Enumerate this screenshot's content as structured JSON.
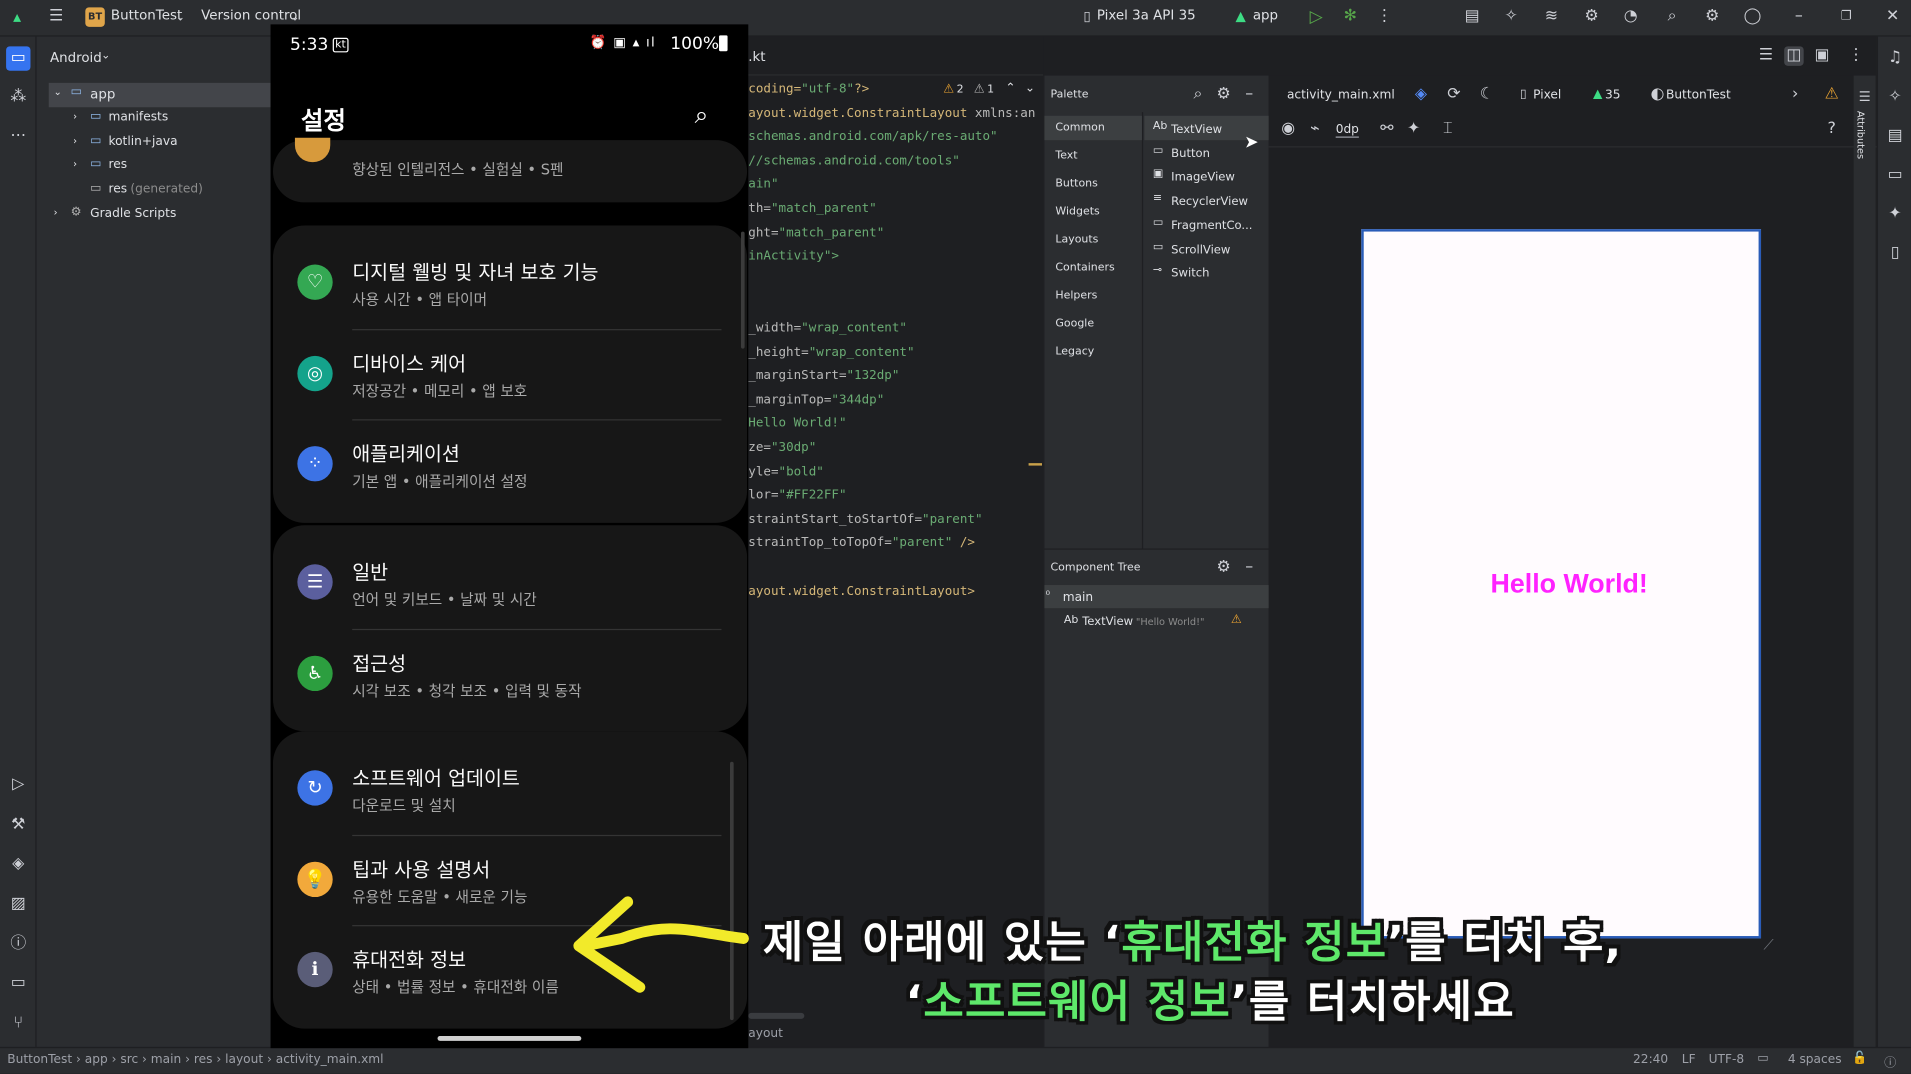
{
  "topbar": {
    "project": "ButtonTest",
    "project_badge": "BT",
    "vcs": "Version control",
    "device": "Pixel 3a API 35",
    "run_config": "app"
  },
  "project_panel": {
    "view": "Android",
    "items": [
      {
        "label": "app"
      },
      {
        "label": "manifests"
      },
      {
        "label": "kotlin+java"
      },
      {
        "label": "res"
      },
      {
        "label": "res",
        "suffix": "(generated)"
      },
      {
        "label": "Gradle Scripts"
      }
    ]
  },
  "editor": {
    "tab": ".kt",
    "warnings": "2",
    "weak_warnings": "1",
    "lines": [
      {
        "parts": [
          [
            "coding=",
            "#d5b778"
          ],
          [
            "\"utf-8\"",
            "#6aab73"
          ],
          [
            "?>",
            "#d5b778"
          ]
        ]
      },
      {
        "parts": [
          [
            "ayout.widget.ConstraintLayout",
            "#d5b778"
          ],
          [
            " xmlns:an",
            "#bababa"
          ]
        ]
      },
      {
        "parts": [
          [
            "schemas.android.com/apk/res-auto\"",
            "#6aab73"
          ]
        ]
      },
      {
        "parts": [
          [
            "//schemas.android.com/tools\"",
            "#6aab73"
          ]
        ]
      },
      {
        "parts": [
          [
            "ain\"",
            "#6aab73"
          ]
        ]
      },
      {
        "parts": [
          [
            "th=",
            "#bababa"
          ],
          [
            "\"match_parent\"",
            "#6aab73"
          ]
        ]
      },
      {
        "parts": [
          [
            "ght=",
            "#bababa"
          ],
          [
            "\"match_parent\"",
            "#6aab73"
          ]
        ]
      },
      {
        "parts": [
          [
            "inActivity\">",
            "#6aab73"
          ]
        ]
      },
      {
        "parts": []
      },
      {
        "parts": []
      },
      {
        "parts": [
          [
            "_width=",
            "#bababa"
          ],
          [
            "\"wrap_content\"",
            "#6aab73"
          ]
        ]
      },
      {
        "parts": [
          [
            "_height=",
            "#bababa"
          ],
          [
            "\"wrap_content\"",
            "#6aab73"
          ]
        ]
      },
      {
        "parts": [
          [
            "_marginStart=",
            "#bababa"
          ],
          [
            "\"132dp\"",
            "#6aab73"
          ]
        ]
      },
      {
        "parts": [
          [
            "_marginTop=",
            "#bababa"
          ],
          [
            "\"344dp\"",
            "#6aab73"
          ]
        ]
      },
      {
        "parts": [
          [
            "Hello World!\"",
            "#6aab73"
          ]
        ]
      },
      {
        "parts": [
          [
            "ze=",
            "#bababa"
          ],
          [
            "\"30dp\"",
            "#6aab73"
          ]
        ]
      },
      {
        "parts": [
          [
            "yle=",
            "#bababa"
          ],
          [
            "\"bold\"",
            "#6aab73"
          ]
        ]
      },
      {
        "parts": [
          [
            "lor=",
            "#bababa"
          ],
          [
            "\"#FF22FF\"",
            "#6aab73"
          ]
        ]
      },
      {
        "parts": [
          [
            "straintStart_toStartOf=",
            "#bababa"
          ],
          [
            "\"parent\"",
            "#6aab73"
          ]
        ]
      },
      {
        "parts": [
          [
            "straintTop_toTopOf=",
            "#bababa"
          ],
          [
            "\"parent\"",
            "#6aab73"
          ],
          [
            " />",
            "#d5b778"
          ]
        ]
      },
      {
        "parts": []
      },
      {
        "parts": [
          [
            "ayout.widget.ConstraintLayout>",
            "#d5b778"
          ]
        ]
      }
    ],
    "bottom_label": "ayout"
  },
  "palette": {
    "title": "Palette",
    "categories": [
      "Common",
      "Text",
      "Buttons",
      "Widgets",
      "Layouts",
      "Containers",
      "Helpers",
      "Google",
      "Legacy"
    ],
    "widgets": [
      {
        "label": "TextView",
        "icon": "Ab"
      },
      {
        "label": "Button",
        "icon": "▭"
      },
      {
        "label": "ImageView",
        "icon": "▣"
      },
      {
        "label": "RecyclerView",
        "icon": "≡"
      },
      {
        "label": "FragmentCo...",
        "icon": "▭"
      },
      {
        "label": "ScrollView",
        "icon": "▭"
      },
      {
        "label": "Switch",
        "icon": "⊸"
      }
    ]
  },
  "component_tree": {
    "title": "Component Tree",
    "root": "main",
    "child": "TextView",
    "child_hint": "\"Hello World!\""
  },
  "design": {
    "file": "activity_main.xml",
    "device": "Pixel",
    "api": "35",
    "theme": "ButtonTest",
    "margin": "0dp",
    "preview_text": "Hello World!",
    "preview_color": "#FF22FF",
    "attributes_label": "Attributes"
  },
  "phone": {
    "time": "5:33",
    "status_right": "100%",
    "header": "설정",
    "top_partial": {
      "subtitle": "향상된 인텔리전스 • 실험실 • S펜"
    },
    "groups": [
      [
        {
          "title": "디지털 웰빙 및 자녀 보호 기능",
          "subtitle": "사용 시간 • 앱 타이머",
          "color": "#34a853",
          "icon": "♡"
        },
        {
          "title": "디바이스 케어",
          "subtitle": "저장공간 • 메모리 • 앱 보호",
          "color": "#14a38b",
          "icon": "◎"
        },
        {
          "title": "애플리케이션",
          "subtitle": "기본 앱 • 애플리케이션 설정",
          "color": "#3d73e5",
          "icon": "⁘"
        }
      ],
      [
        {
          "title": "일반",
          "subtitle": "언어 및 키보드 • 날짜 및 시간",
          "color": "#5b5f9e",
          "icon": "☰"
        },
        {
          "title": "접근성",
          "subtitle": "시각 보조 • 청각 보조 • 입력 및 동작",
          "color": "#2c9e3f",
          "icon": "♿"
        }
      ],
      [
        {
          "title": "소프트웨어 업데이트",
          "subtitle": "다운로드 및 설치",
          "color": "#3d73e5",
          "icon": "↻"
        },
        {
          "title": "팁과 사용 설명서",
          "subtitle": "유용한 도움말 • 새로운 기능",
          "color": "#f2a93b",
          "icon": "💡"
        },
        {
          "title": "휴대전화 정보",
          "subtitle": "상태 • 법률 정보 • 휴대전화 이름",
          "color": "#5a5d78",
          "icon": "ℹ"
        }
      ]
    ]
  },
  "caption": {
    "line1": [
      [
        "제일 아래에 있는 ‘",
        "#ffffff"
      ],
      [
        "휴대전화 정보",
        "#5ee86a"
      ],
      [
        "’를 터치 후,",
        "#ffffff"
      ]
    ],
    "line2": [
      [
        "‘",
        "#ffffff"
      ],
      [
        "소프트웨어 정보",
        "#5ee86a"
      ],
      [
        "’를 터치하세요",
        "#ffffff"
      ]
    ]
  },
  "statusbar": {
    "crumbs": [
      "ButtonTest",
      "app",
      "src",
      "main",
      "res",
      "layout",
      "activity_main.xml"
    ],
    "position": "22:40",
    "line_sep": "LF",
    "encoding": "UTF-8",
    "indent": "4 spaces"
  }
}
